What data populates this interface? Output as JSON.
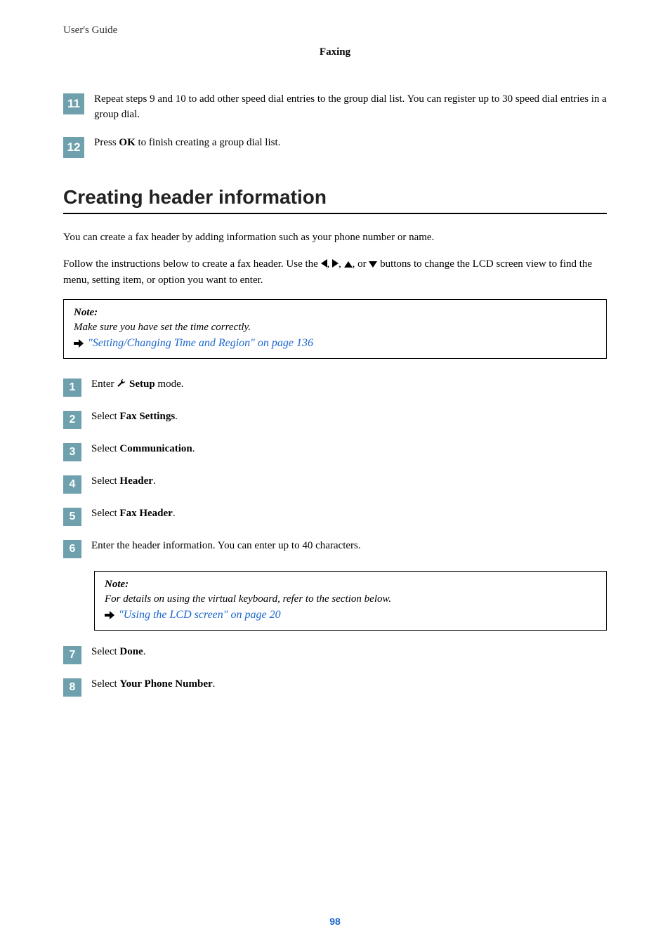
{
  "running_head": "User's Guide",
  "section_label": "Faxing",
  "top_steps": [
    {
      "num": "11",
      "text_parts": [
        "Repeat steps 9 and 10 to add other speed dial entries to the group dial list. You can register up to 30 speed dial entries in a group dial."
      ]
    },
    {
      "num": "12",
      "text_parts": [
        "Press ",
        "OK",
        " to finish creating a group dial list."
      ]
    }
  ],
  "heading": "Creating header information",
  "intro1": "You can create a fax header by adding information such as your phone number or name.",
  "intro2_prefix": "Follow the instructions below to create a fax header. Use the ",
  "intro2_suffix": " buttons to change the LCD screen view to find the menu, setting item, or option you want to enter.",
  "note1": {
    "title": "Note:",
    "body": "Make sure you have set the time correctly.",
    "xref": "\"Setting/Changing Time and Region\" on page 136"
  },
  "steps": [
    {
      "num": "1",
      "parts": [
        "Enter ",
        "ICON",
        " ",
        "Setup",
        " mode."
      ]
    },
    {
      "num": "2",
      "parts": [
        "Select ",
        "Fax Settings",
        "."
      ]
    },
    {
      "num": "3",
      "parts": [
        "Select ",
        "Communication",
        "."
      ]
    },
    {
      "num": "4",
      "parts": [
        "Select ",
        "Header",
        "."
      ]
    },
    {
      "num": "5",
      "parts": [
        "Select ",
        "Fax Header",
        "."
      ]
    },
    {
      "num": "6",
      "parts": [
        "Enter the header information. You can enter up to 40 characters."
      ]
    },
    {
      "num": "7",
      "parts": [
        "Select ",
        "Done",
        "."
      ]
    },
    {
      "num": "8",
      "parts": [
        "Select ",
        "Your Phone Number",
        "."
      ]
    }
  ],
  "note2": {
    "title": "Note:",
    "body": "For details on using the virtual keyboard, refer to the section below.",
    "xref": "\"Using the LCD screen\" on page 20"
  },
  "page_number": "98",
  "arrow_joiners": {
    "comma": ", ",
    "or": ", or "
  }
}
